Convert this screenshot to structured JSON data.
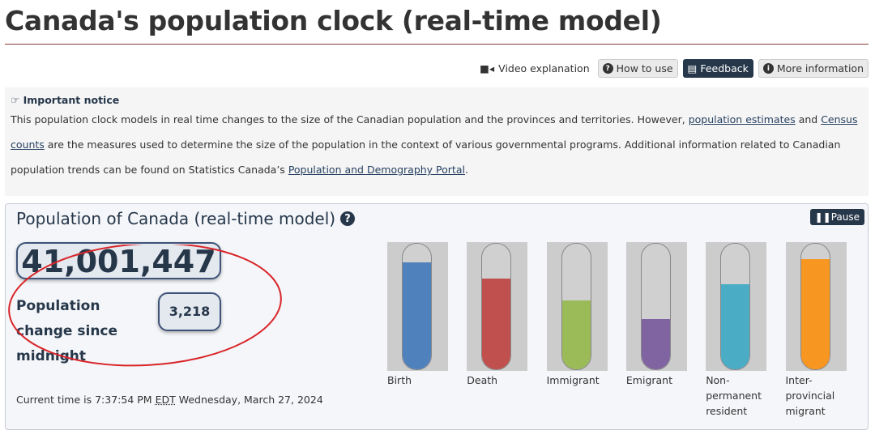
{
  "page_title": "Canada's population clock (real-time model)",
  "toolbar": {
    "video": "Video explanation",
    "how_to_use": "How to use",
    "feedback": "Feedback",
    "more_info": "More information"
  },
  "notice": {
    "heading": "Important notice",
    "text1": "This population clock models in real time changes to the size of the Canadian population and the provinces and territories. However, ",
    "link1": "population estimates",
    "text2": " and ",
    "link2": "Census counts",
    "text3": " are the measures used to determine the size of the population in the context of various governmental programs. Additional information related to Canadian population trends can be found on Statistics Canada’s ",
    "link3": "Population and Demography Portal",
    "text4": "."
  },
  "panel": {
    "title": "Population of Canada (real-time model)",
    "pause": "Pause",
    "population": "41,001,447",
    "change_label": "Population change since midnight",
    "change_value": "3,218",
    "time_prefix": "Current time is 7:37:54 PM ",
    "time_zone": "EDT",
    "time_suffix": " Wednesday, March 27, 2024"
  },
  "tubes": [
    {
      "label": "Birth",
      "level": 0.85,
      "color": "#4f81bd"
    },
    {
      "label": "Death",
      "level": 0.72,
      "color": "#c0504d"
    },
    {
      "label": "Immigrant",
      "level": 0.55,
      "color": "#9bbb59"
    },
    {
      "label": "Emigrant",
      "level": 0.4,
      "color": "#8064a2"
    },
    {
      "label": "Non-permanent resident",
      "level": 0.68,
      "color": "#4bacc6"
    },
    {
      "label": "Inter-provincial migrant",
      "level": 0.88,
      "color": "#f79620"
    }
  ],
  "annotation_color": "#d9262a"
}
